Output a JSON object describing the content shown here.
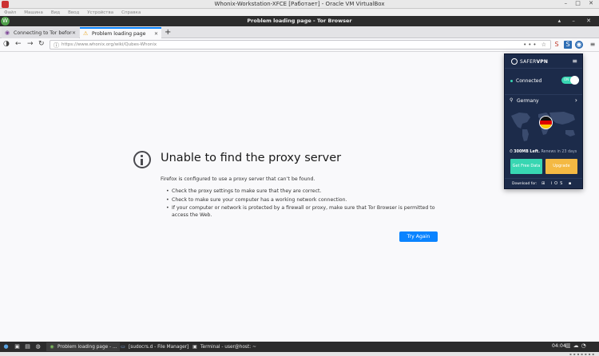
{
  "vbox": {
    "window_title": "Whonix-Workstation-XFCE [Работает] - Oracle VM VirtualBox",
    "controls": "– □ ✕",
    "menu": [
      "Файл",
      "Машина",
      "Вид",
      "Ввод",
      "Устройства",
      "Справка"
    ]
  },
  "guest_panel": {
    "window_title": "Problem loading page - Tor Browser",
    "controls": "▴ – ✕"
  },
  "browser": {
    "tabs": [
      {
        "label": "Connecting to Tor before a W",
        "icon": "tor-icon",
        "active": false
      },
      {
        "label": "Problem loading page",
        "icon": "warning-icon",
        "active": true
      }
    ],
    "new_tab": "+",
    "close_glyph": "✕",
    "url": "https://www.whonix.org/wiki/Qubes-Whonix",
    "url_actions": "•••",
    "bookmark_glyph": "☆"
  },
  "error_page": {
    "title": "Unable to find the proxy server",
    "description": "Firefox is configured to use a proxy server that can’t be found.",
    "bullets": [
      "Check the proxy settings to make sure that they are correct.",
      "Check to make sure your computer has a working network connection.",
      "If your computer or network is protected by a firewall or proxy, make sure that Tor Browser is permitted to access the Web."
    ],
    "button": "Try Again",
    "accent_color": "#0a84ff"
  },
  "vpn_popup": {
    "brand_light": "SAFER",
    "brand_bold": "VPN",
    "menu_glyph": "≡",
    "status": "Connected",
    "toggle_label": "ON",
    "country": "Germany",
    "usage_amount": "300MB Left.",
    "usage_renew": "Renews in 23 days",
    "btn_free": "Get Free Data",
    "btn_upgrade": "Upgrade",
    "download_label": "Download for:",
    "platforms": "⊞  iOS ▪",
    "colors": {
      "bg": "#1c2b4a",
      "teal": "#38d6b2",
      "orange": "#f4b943"
    }
  },
  "taskbar": {
    "tasks": [
      {
        "label": "Problem loading page - ...",
        "icon": "tor-browser-icon",
        "active": true
      },
      {
        "label": "[sudocrs.d - File Manager]",
        "icon": "folder-icon",
        "active": false
      },
      {
        "label": "Terminal - user@host: ~",
        "icon": "terminal-icon",
        "active": false
      }
    ],
    "clock": "04:04"
  }
}
